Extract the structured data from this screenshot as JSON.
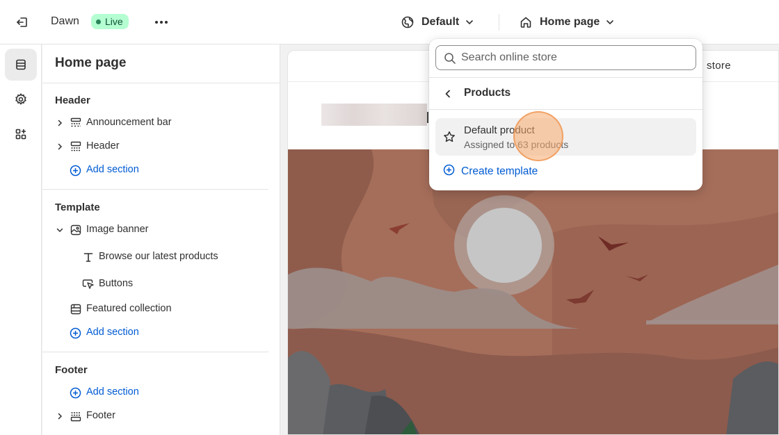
{
  "topbar": {
    "theme_name": "Dawn",
    "live_label": "Live",
    "theme_selector_label": "Default",
    "page_selector_label": "Home page"
  },
  "sidebar": {
    "title": "Home page",
    "groups": {
      "header": {
        "title": "Header",
        "items": [
          "Announcement bar",
          "Header"
        ],
        "add_label": "Add section"
      },
      "template": {
        "title": "Template",
        "image_banner": "Image banner",
        "banner_children": [
          "Browse our latest products",
          "Buttons"
        ],
        "featured": "Featured collection",
        "add_label": "Add section"
      },
      "footer": {
        "title": "Footer",
        "add_label": "Add section",
        "items": [
          "Footer"
        ]
      }
    }
  },
  "preview": {
    "header_text": "store"
  },
  "dropdown": {
    "search_placeholder": "Search online store",
    "heading": "Products",
    "item_title": "Default product",
    "item_subtitle": "Assigned to 63 products",
    "create_label": "Create template"
  },
  "colors": {
    "accent_link": "#005bd3",
    "live_bg": "#b4fed2",
    "live_dot": "#29845a"
  }
}
